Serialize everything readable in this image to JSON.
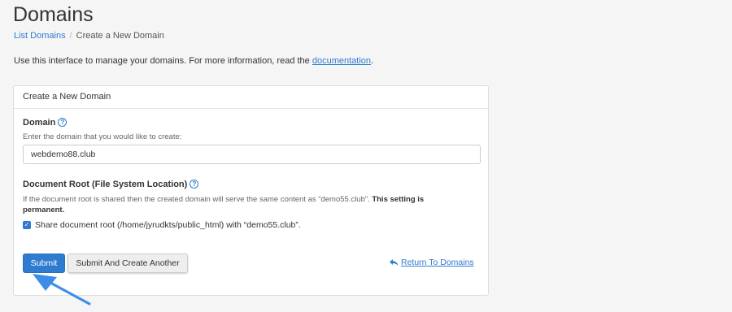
{
  "page": {
    "title": "Domains"
  },
  "breadcrumb": {
    "parent": "List Domains",
    "separator": "/",
    "current": "Create a New Domain"
  },
  "intro": {
    "text": "Use this interface to manage your domains. For more information, read the ",
    "link": "documentation",
    "end": "."
  },
  "panel": {
    "heading": "Create a New Domain",
    "domain_label": "Domain",
    "domain_hint": "Enter the domain that you would like to create:",
    "domain_value": "webdemo88.club",
    "docroot_label": "Document Root (File System Location)",
    "docroot_warning": "If the document root is shared then the created domain will serve the same content as “demo55.club”. ",
    "docroot_warning_bold": "This setting is permanent.",
    "share_checked": true,
    "share_label": "Share document root (/home/jyrudkts/public_html) with “demo55.club”."
  },
  "buttons": {
    "submit": "Submit",
    "submit_another": "Submit And Create Another",
    "return": "Return To Domains"
  },
  "colors": {
    "accent": "#2e7bcf",
    "annotation_arrow": "#3b8de8"
  },
  "icons": {
    "help": "question-circle-icon",
    "return": "reply-arrow-icon",
    "annotation": "pointer-arrow-icon"
  }
}
